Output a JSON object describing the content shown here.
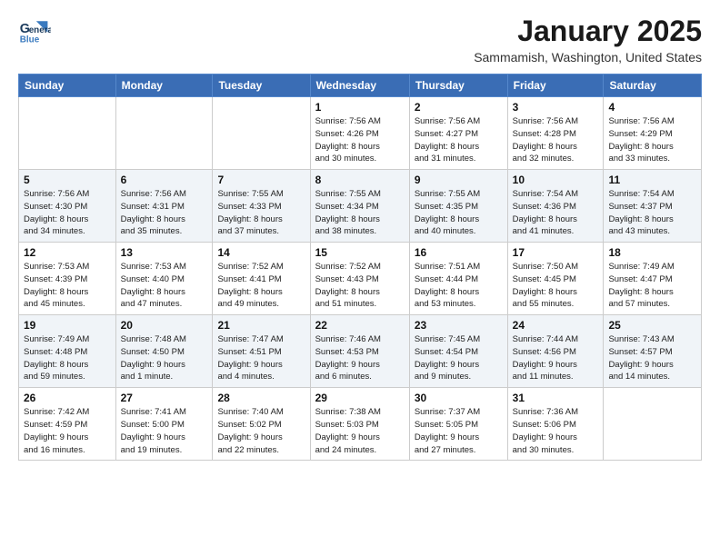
{
  "header": {
    "logo_line1": "General",
    "logo_line2": "Blue",
    "month": "January 2025",
    "location": "Sammamish, Washington, United States"
  },
  "days_of_week": [
    "Sunday",
    "Monday",
    "Tuesday",
    "Wednesday",
    "Thursday",
    "Friday",
    "Saturday"
  ],
  "weeks": [
    [
      {
        "day": "",
        "info": ""
      },
      {
        "day": "",
        "info": ""
      },
      {
        "day": "",
        "info": ""
      },
      {
        "day": "1",
        "info": "Sunrise: 7:56 AM\nSunset: 4:26 PM\nDaylight: 8 hours\nand 30 minutes."
      },
      {
        "day": "2",
        "info": "Sunrise: 7:56 AM\nSunset: 4:27 PM\nDaylight: 8 hours\nand 31 minutes."
      },
      {
        "day": "3",
        "info": "Sunrise: 7:56 AM\nSunset: 4:28 PM\nDaylight: 8 hours\nand 32 minutes."
      },
      {
        "day": "4",
        "info": "Sunrise: 7:56 AM\nSunset: 4:29 PM\nDaylight: 8 hours\nand 33 minutes."
      }
    ],
    [
      {
        "day": "5",
        "info": "Sunrise: 7:56 AM\nSunset: 4:30 PM\nDaylight: 8 hours\nand 34 minutes."
      },
      {
        "day": "6",
        "info": "Sunrise: 7:56 AM\nSunset: 4:31 PM\nDaylight: 8 hours\nand 35 minutes."
      },
      {
        "day": "7",
        "info": "Sunrise: 7:55 AM\nSunset: 4:33 PM\nDaylight: 8 hours\nand 37 minutes."
      },
      {
        "day": "8",
        "info": "Sunrise: 7:55 AM\nSunset: 4:34 PM\nDaylight: 8 hours\nand 38 minutes."
      },
      {
        "day": "9",
        "info": "Sunrise: 7:55 AM\nSunset: 4:35 PM\nDaylight: 8 hours\nand 40 minutes."
      },
      {
        "day": "10",
        "info": "Sunrise: 7:54 AM\nSunset: 4:36 PM\nDaylight: 8 hours\nand 41 minutes."
      },
      {
        "day": "11",
        "info": "Sunrise: 7:54 AM\nSunset: 4:37 PM\nDaylight: 8 hours\nand 43 minutes."
      }
    ],
    [
      {
        "day": "12",
        "info": "Sunrise: 7:53 AM\nSunset: 4:39 PM\nDaylight: 8 hours\nand 45 minutes."
      },
      {
        "day": "13",
        "info": "Sunrise: 7:53 AM\nSunset: 4:40 PM\nDaylight: 8 hours\nand 47 minutes."
      },
      {
        "day": "14",
        "info": "Sunrise: 7:52 AM\nSunset: 4:41 PM\nDaylight: 8 hours\nand 49 minutes."
      },
      {
        "day": "15",
        "info": "Sunrise: 7:52 AM\nSunset: 4:43 PM\nDaylight: 8 hours\nand 51 minutes."
      },
      {
        "day": "16",
        "info": "Sunrise: 7:51 AM\nSunset: 4:44 PM\nDaylight: 8 hours\nand 53 minutes."
      },
      {
        "day": "17",
        "info": "Sunrise: 7:50 AM\nSunset: 4:45 PM\nDaylight: 8 hours\nand 55 minutes."
      },
      {
        "day": "18",
        "info": "Sunrise: 7:49 AM\nSunset: 4:47 PM\nDaylight: 8 hours\nand 57 minutes."
      }
    ],
    [
      {
        "day": "19",
        "info": "Sunrise: 7:49 AM\nSunset: 4:48 PM\nDaylight: 8 hours\nand 59 minutes."
      },
      {
        "day": "20",
        "info": "Sunrise: 7:48 AM\nSunset: 4:50 PM\nDaylight: 9 hours\nand 1 minute."
      },
      {
        "day": "21",
        "info": "Sunrise: 7:47 AM\nSunset: 4:51 PM\nDaylight: 9 hours\nand 4 minutes."
      },
      {
        "day": "22",
        "info": "Sunrise: 7:46 AM\nSunset: 4:53 PM\nDaylight: 9 hours\nand 6 minutes."
      },
      {
        "day": "23",
        "info": "Sunrise: 7:45 AM\nSunset: 4:54 PM\nDaylight: 9 hours\nand 9 minutes."
      },
      {
        "day": "24",
        "info": "Sunrise: 7:44 AM\nSunset: 4:56 PM\nDaylight: 9 hours\nand 11 minutes."
      },
      {
        "day": "25",
        "info": "Sunrise: 7:43 AM\nSunset: 4:57 PM\nDaylight: 9 hours\nand 14 minutes."
      }
    ],
    [
      {
        "day": "26",
        "info": "Sunrise: 7:42 AM\nSunset: 4:59 PM\nDaylight: 9 hours\nand 16 minutes."
      },
      {
        "day": "27",
        "info": "Sunrise: 7:41 AM\nSunset: 5:00 PM\nDaylight: 9 hours\nand 19 minutes."
      },
      {
        "day": "28",
        "info": "Sunrise: 7:40 AM\nSunset: 5:02 PM\nDaylight: 9 hours\nand 22 minutes."
      },
      {
        "day": "29",
        "info": "Sunrise: 7:38 AM\nSunset: 5:03 PM\nDaylight: 9 hours\nand 24 minutes."
      },
      {
        "day": "30",
        "info": "Sunrise: 7:37 AM\nSunset: 5:05 PM\nDaylight: 9 hours\nand 27 minutes."
      },
      {
        "day": "31",
        "info": "Sunrise: 7:36 AM\nSunset: 5:06 PM\nDaylight: 9 hours\nand 30 minutes."
      },
      {
        "day": "",
        "info": ""
      }
    ]
  ]
}
